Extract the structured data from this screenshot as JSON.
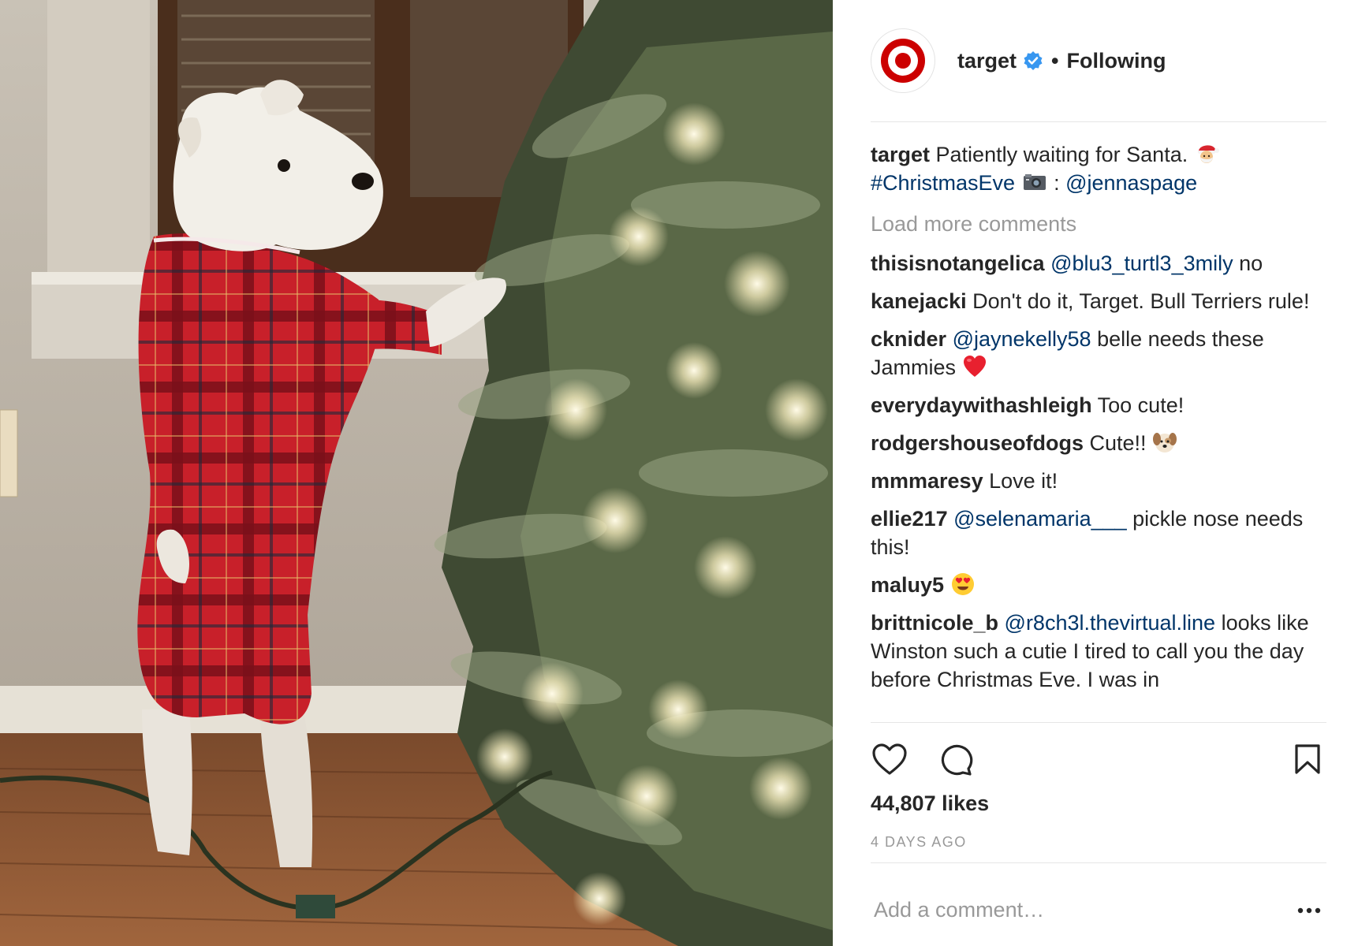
{
  "photo": {
    "description_icon": "photo-dog-in-plaid-pajamas-by-christmas-tree"
  },
  "header": {
    "username": "target",
    "separator": "•",
    "follow_state": "Following",
    "avatar_icon": "target-bullseye-logo",
    "verified_icon": "verified-badge-icon",
    "brand_color": "#cc0000",
    "verified_color": "#3897f0"
  },
  "caption": {
    "user": "target",
    "text": "Patiently waiting for Santa. ",
    "emoji": "santa-emoji",
    "hashtag": "#ChristmasEve",
    "camera_icon": "camera-emoji",
    "credit_sep": " : ",
    "credit": "@jennaspage"
  },
  "load_more": "Load more comments",
  "comments": [
    {
      "user": "thisisnotangelica",
      "mention": "@blu3_turtl3_3mily",
      "text": " no"
    },
    {
      "user": "kanejacki",
      "mention": "",
      "text": " Don't do it, Target. Bull Terriers rule!"
    },
    {
      "user": "cknider",
      "mention": "@jaynekelly58",
      "text": " belle needs these Jammies ",
      "emoji": "red-heart-emoji"
    },
    {
      "user": "everydaywithashleigh",
      "mention": "",
      "text": " Too cute!"
    },
    {
      "user": "rodgershouseofdogs",
      "mention": "",
      "text": " Cute!! ",
      "emoji": "dog-face-emoji"
    },
    {
      "user": "mmmaresy",
      "mention": "",
      "text": " Love it!"
    },
    {
      "user": "ellie217",
      "mention": "@selenamaria___",
      "text": " pickle nose needs this!"
    },
    {
      "user": "maluy5",
      "mention": "",
      "text": " ",
      "emoji": "heart-eyes-emoji"
    },
    {
      "user": "brittnicole_b",
      "mention": "@r8ch3l.thevirtual.line",
      "text": " looks like Winston such a cutie I tired to call you the day before Christmas Eve. I was in"
    }
  ],
  "actions": {
    "like_icon": "heart-outline-icon",
    "comment_icon": "comment-bubble-icon",
    "save_icon": "bookmark-icon"
  },
  "likes": "44,807 likes",
  "timestamp": "4 DAYS AGO",
  "add_comment": {
    "placeholder": "Add a comment…",
    "value": ""
  },
  "more_icon": "ellipsis-icon"
}
